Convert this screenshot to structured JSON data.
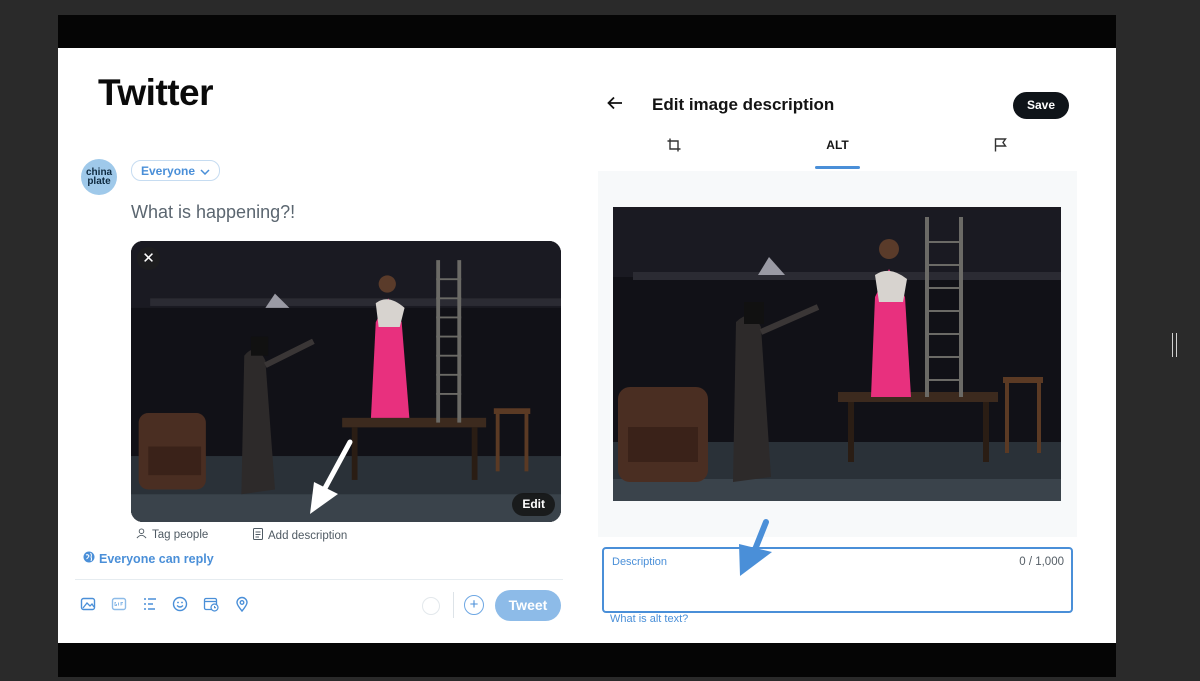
{
  "slide": {
    "title": "Twitter"
  },
  "compose": {
    "avatar_text": "china plate",
    "audience_label": "Everyone",
    "prompt": "What is happening?!",
    "media": {
      "close_icon": "close-icon",
      "edit_label": "Edit"
    },
    "tag_people_label": "Tag people",
    "add_description_label": "Add description",
    "reply_setting_label": "Everyone can reply",
    "toolbar": {
      "icons": [
        "image-icon",
        "gif-icon",
        "poll-icon",
        "emoji-icon",
        "schedule-icon",
        "location-icon"
      ],
      "tweet_label": "Tweet"
    }
  },
  "modal": {
    "title": "Edit image description",
    "save_label": "Save",
    "tabs": [
      {
        "name": "crop-icon",
        "label": ""
      },
      {
        "name": "alt",
        "label": "ALT"
      },
      {
        "name": "flag-icon",
        "label": ""
      }
    ],
    "active_tab": "ALT",
    "description": {
      "label": "Description",
      "value": "",
      "count": "0 / 1,000"
    },
    "alt_help_link": "What is alt text?"
  },
  "colors": {
    "accent": "#4a8fd8",
    "tweet_button": "#8dbbe8",
    "save_button": "#0f1419",
    "costume_pink": "#e8307e"
  }
}
